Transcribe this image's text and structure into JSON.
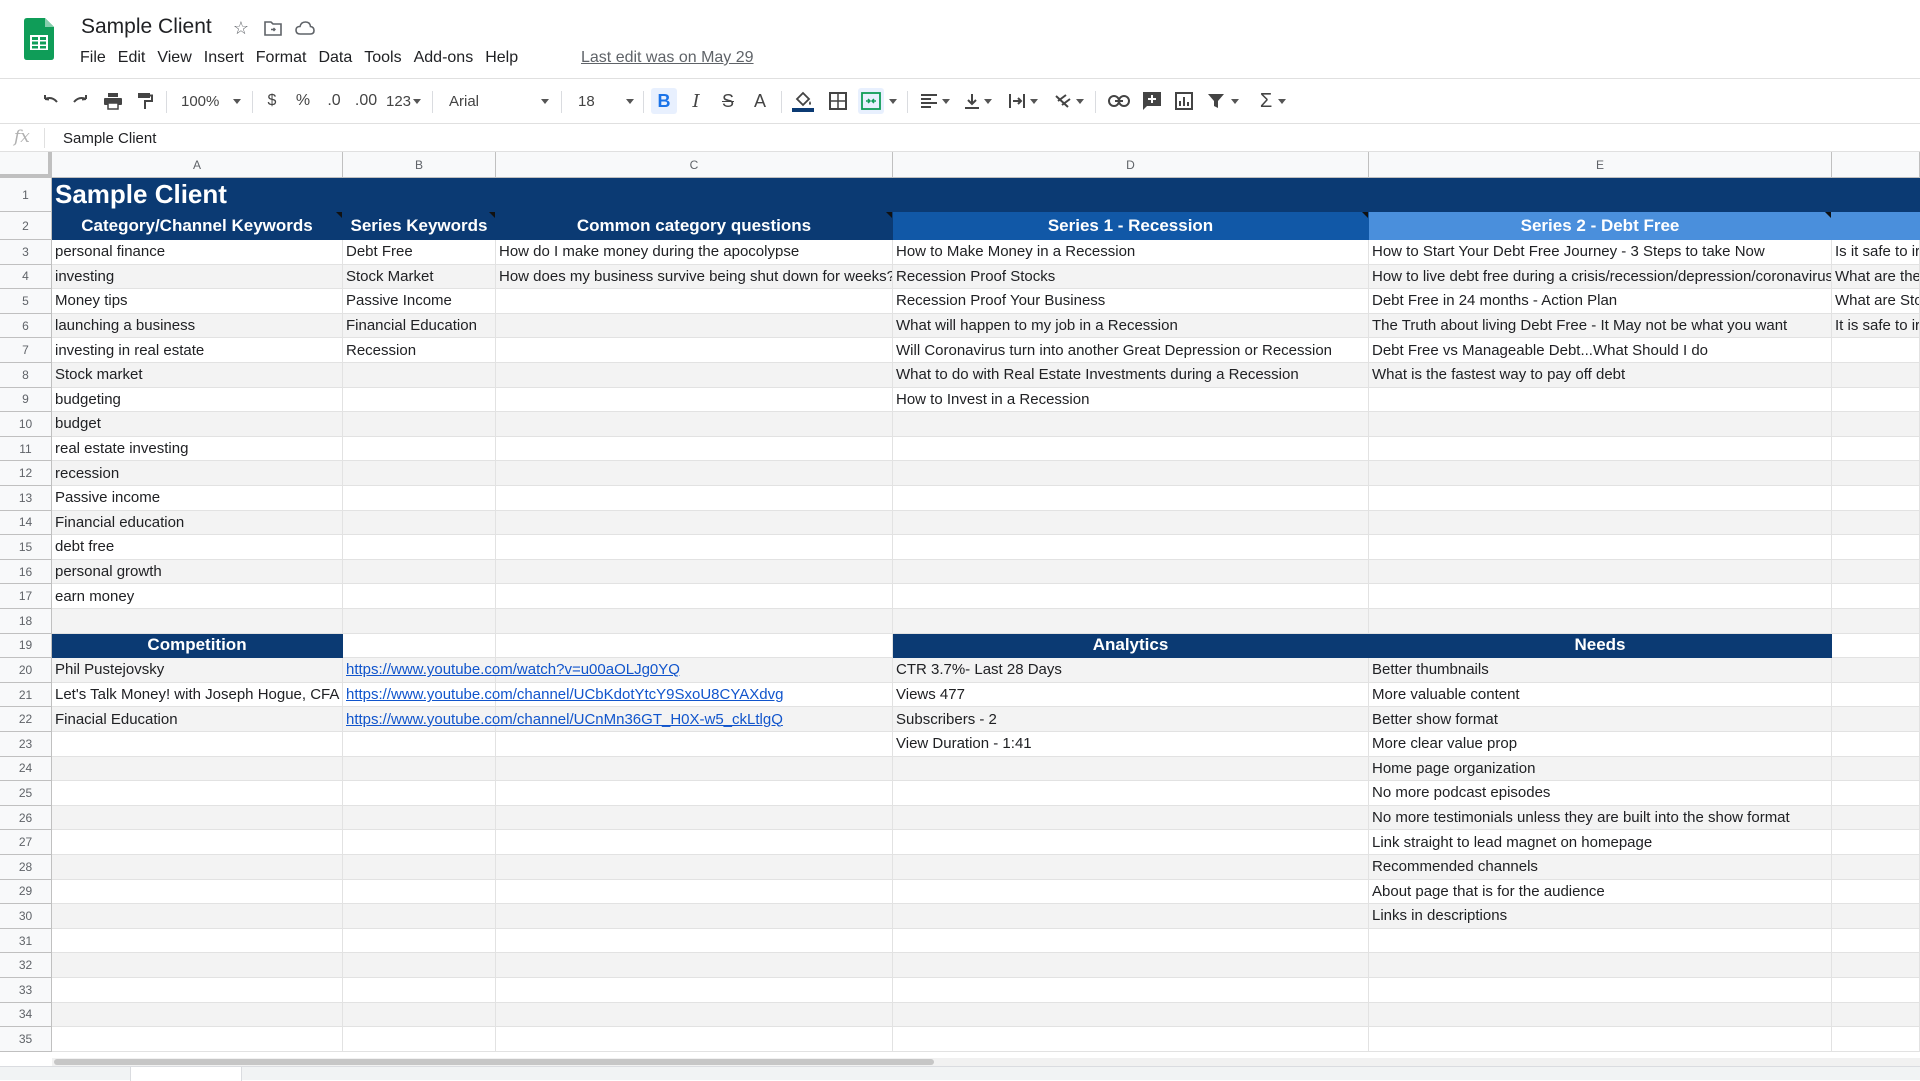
{
  "app": {
    "doc_title": "Sample Client",
    "last_edit": "Last edit was on May 29",
    "menu": [
      "File",
      "Edit",
      "View",
      "Insert",
      "Format",
      "Data",
      "Tools",
      "Add-ons",
      "Help"
    ]
  },
  "toolbar": {
    "zoom": "100%",
    "currency": "$",
    "percent": "%",
    "dec_less": ".0",
    "dec_more": ".00",
    "more_formats": "123",
    "font": "Arial",
    "font_size": "18",
    "bold": "B",
    "italic": "I",
    "strike": "S",
    "text_color": "A",
    "sum": "Σ"
  },
  "formula_bar": {
    "fx": "fx",
    "value": "Sample Client"
  },
  "columns": [
    "A",
    "B",
    "C",
    "D",
    "E"
  ],
  "rows": [
    "1",
    "2",
    "3",
    "4",
    "5",
    "6",
    "7",
    "8",
    "9",
    "10",
    "11",
    "12",
    "13",
    "14",
    "15",
    "16",
    "17",
    "18",
    "19",
    "20",
    "21",
    "22",
    "23",
    "24",
    "25",
    "26",
    "27",
    "28",
    "29",
    "30",
    "31",
    "32",
    "33",
    "34",
    "35"
  ],
  "sheet": {
    "title": "Sample Client",
    "headers": {
      "a": "Category/Channel Keywords",
      "b": "Series Keywords",
      "c": "Common category questions",
      "d": "Series 1 - Recession",
      "e": "Series 2 - Debt Free"
    },
    "col_a": [
      "personal finance",
      "investing",
      "Money tips",
      "launching a business",
      "investing in real estate",
      "Stock market",
      "budgeting",
      "budget",
      "real estate investing",
      "recession",
      "Passive income",
      "Financial education",
      "debt free",
      "personal growth",
      "earn money"
    ],
    "col_b": [
      "Debt Free",
      "Stock Market",
      "Passive Income",
      "Financial Education",
      "Recession"
    ],
    "col_c": [
      "How do I make money during the apocolypse",
      "How does my business survive being shut down for weeks?"
    ],
    "col_d": [
      "How to Make Money in a Recession",
      "Recession Proof Stocks",
      "Recession Proof Your Business",
      "What will happen to my job in a Recession",
      "Will Coronavirus turn into another Great Depression or Recession",
      "What to do with Real Estate Investments during a Recession",
      "How to Invest in a Recession"
    ],
    "col_e": [
      "How to Start Your Debt Free Journey - 3 Steps to take Now",
      "How to live debt free during a crisis/recession/depression/coronavirus",
      "Debt Free in 24 months - Action Plan",
      "The Truth about living Debt Free - It May not be what you want",
      "Debt Free vs Manageable Debt...What Should I do",
      "What is the fastest way to pay off debt"
    ],
    "col_f": [
      "Is it safe to ir",
      "What are the",
      "What are Sto",
      "It is safe to ir"
    ],
    "competition": {
      "header": "Competition",
      "names": [
        "Phil Pustejovsky",
        "Let's Talk Money! with Joseph Hogue, CFA",
        "Finacial Education"
      ],
      "links": [
        "https://www.youtube.com/watch?v=u00aOLJg0YQ",
        "https://www.youtube.com/channel/UCbKdotYtcY9SxoU8CYAXdvg",
        "https://www.youtube.com/channel/UCnMn36GT_H0X-w5_ckLtlgQ"
      ]
    },
    "analytics": {
      "header": "Analytics",
      "items": [
        "CTR 3.7%- Last 28 Days",
        "Views 477",
        "Subscribers - 2",
        "View Duration - 1:41"
      ]
    },
    "needs": {
      "header": "Needs",
      "items": [
        "Better thumbnails",
        "More valuable content",
        "Better show format",
        "More clear value prop",
        "Home page organization",
        "No more podcast episodes",
        "No more testimonials unless they are built into the show format",
        "Link straight to lead magnet on homepage",
        "Recommended channels",
        "About page that is for the audience",
        "Links in descriptions"
      ]
    }
  },
  "colors": {
    "header_dark": "#0b3a73",
    "header_mid": "#1158a7",
    "header_light": "#4a8fdc",
    "link": "#1155cc",
    "sheets_green": "#0f9d58"
  }
}
